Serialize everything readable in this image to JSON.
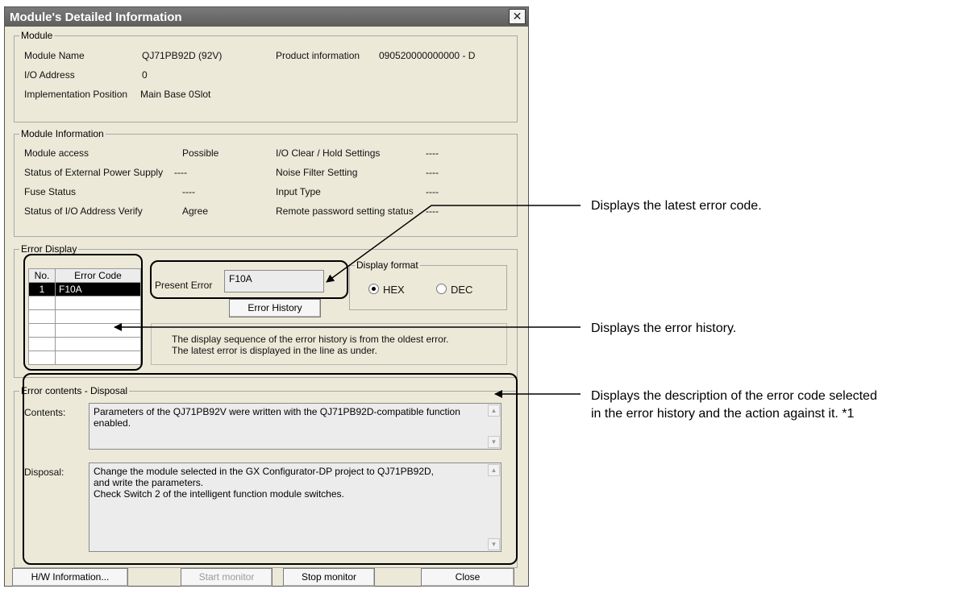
{
  "window": {
    "title": "Module's Detailed Information",
    "close_glyph": "✕"
  },
  "module": {
    "legend": "Module",
    "name_label": "Module Name",
    "name_value": "QJ71PB92D (92V)",
    "product_label": "Product information",
    "product_value": "090520000000000 - D",
    "io_label": "I/O Address",
    "io_value": "0",
    "position_label": "Implementation Position",
    "position_value": "Main Base  0Slot"
  },
  "module_info": {
    "legend": "Module Information",
    "rows": [
      {
        "label": "Module access",
        "value": "Possible",
        "label2": "I/O Clear / Hold Settings",
        "value2": "----"
      },
      {
        "label": "Status of External Power Supply",
        "value": "----",
        "label2": "Noise Filter Setting",
        "value2": "----"
      },
      {
        "label": "Fuse Status",
        "value": "----",
        "label2": "Input Type",
        "value2": "----"
      },
      {
        "label": "Status of I/O Address Verify",
        "value": "Agree",
        "label2": "Remote password setting status",
        "value2": "----"
      }
    ]
  },
  "error_display": {
    "legend": "Error Display",
    "table_headers": [
      "No.",
      "Error Code"
    ],
    "rows": [
      {
        "no": "1",
        "code": "F10A"
      }
    ],
    "present_error_label": "Present Error",
    "present_error_value": "F10A",
    "error_history_button": "Error History",
    "display_format": {
      "legend": "Display format",
      "hex": "HEX",
      "dec": "DEC",
      "selected": "HEX"
    },
    "note_line1": "The display sequence of the error history is from the oldest error.",
    "note_line2": "The latest error is displayed in the line as under."
  },
  "error_contents": {
    "legend": "Error contents - Disposal",
    "contents_label": "Contents:",
    "contents_text": "Parameters of the QJ71PB92V were written with the QJ71PB92D-compatible function enabled.",
    "disposal_label": "Disposal:",
    "disposal_line1": "Change the module selected in the GX Configurator-DP project to QJ71PB92D,",
    "disposal_line2": "and write the parameters.",
    "disposal_line3": "Check Switch 2 of the intelligent function module switches."
  },
  "buttons": {
    "hw_info": "H/W Information...",
    "start_monitor": "Start monitor",
    "stop_monitor": "Stop monitor",
    "close": "Close"
  },
  "annotations": {
    "latest_error": "Displays the latest error code.",
    "history": "Displays the error history.",
    "description_line1": "Displays the description of the error code selected",
    "description_line2": "in the error history and the action against it. *1"
  }
}
